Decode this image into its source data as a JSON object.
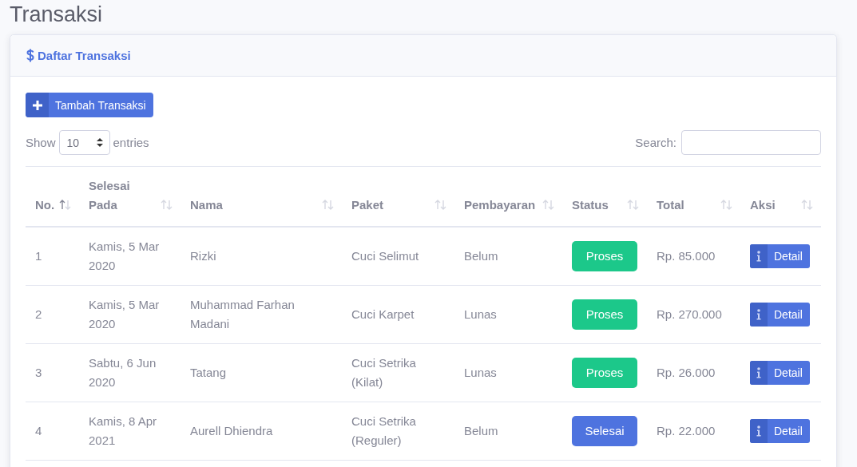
{
  "page_title": "Transaksi",
  "card": {
    "title": "Daftar Transaksi"
  },
  "add_button": {
    "label": "Tambah Transaksi"
  },
  "length_control": {
    "prefix": "Show",
    "value": "10",
    "suffix": "entries"
  },
  "search": {
    "label": "Search:"
  },
  "table": {
    "columns": [
      {
        "label": "No.",
        "sorted_ascending": true
      },
      {
        "label": "Selesai Pada",
        "sorted_ascending": false
      },
      {
        "label": "Nama",
        "sorted_ascending": false
      },
      {
        "label": "Paket",
        "sorted_ascending": false
      },
      {
        "label": "Pembayaran",
        "sorted_ascending": false
      },
      {
        "label": "Status",
        "sorted_ascending": false
      },
      {
        "label": "Total",
        "sorted_ascending": false
      },
      {
        "label": "Aksi",
        "sorted_ascending": false
      }
    ],
    "rows": [
      {
        "no": "1",
        "date": "Kamis, 5 Mar 2020",
        "name": "Rizki",
        "package": "Cuci Selimut",
        "payment": "Belum",
        "status": {
          "label": "Proses",
          "kind": "process"
        },
        "total": "Rp. 85.000",
        "action": "Detail"
      },
      {
        "no": "2",
        "date": "Kamis, 5 Mar 2020",
        "name": "Muhammad Farhan Madani",
        "package": "Cuci Karpet",
        "payment": "Lunas",
        "status": {
          "label": "Proses",
          "kind": "process"
        },
        "total": "Rp. 270.000",
        "action": "Detail"
      },
      {
        "no": "3",
        "date": "Sabtu, 6 Jun 2020",
        "name": "Tatang",
        "package": "Cuci Setrika (Kilat)",
        "payment": "Lunas",
        "status": {
          "label": "Proses",
          "kind": "process"
        },
        "total": "Rp. 26.000",
        "action": "Detail"
      },
      {
        "no": "4",
        "date": "Kamis, 8 Apr 2021",
        "name": "Aurell Dhiendra",
        "package": "Cuci Setrika (Reguler)",
        "payment": "Belum",
        "status": {
          "label": "Selesai",
          "kind": "done"
        },
        "total": "Rp. 22.000",
        "action": "Detail"
      }
    ]
  }
}
